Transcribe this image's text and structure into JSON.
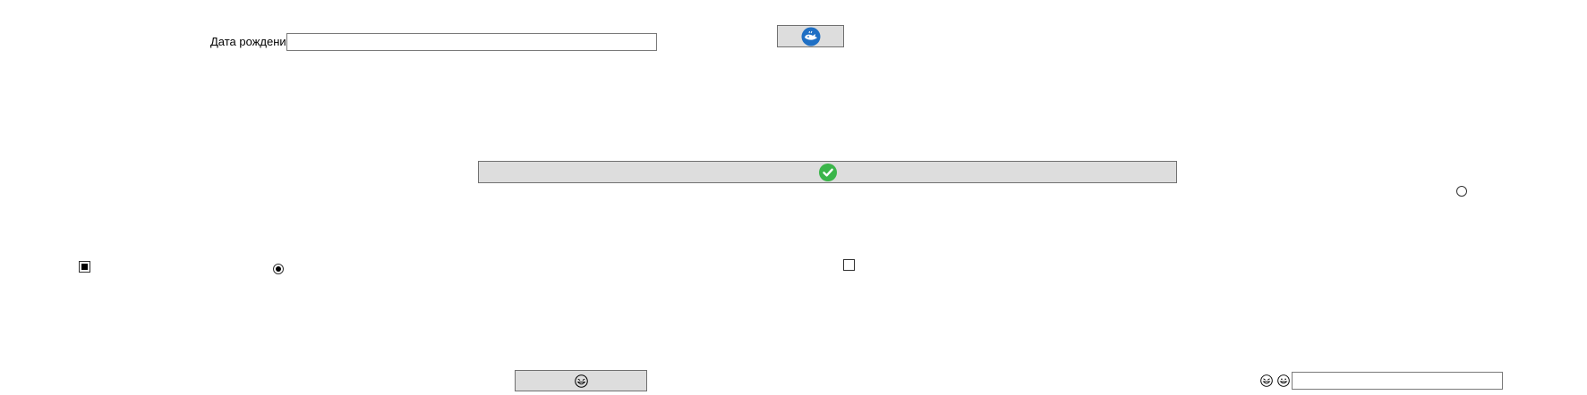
{
  "form": {
    "birth_date_label": "Дата рождения",
    "birth_date_value": "",
    "text_field_value": ""
  },
  "controls": {
    "checkbox_left_checked": true,
    "checkbox_middle_checked": false,
    "radio_left_selected": true,
    "radio_right_selected": false
  },
  "icons": {
    "top_button_icon": "whale-icon",
    "wide_button_icon": "green-checkmark-icon",
    "bottom_button_icon": "laughing-face-icon",
    "emoji_left": "laughing-face-icon",
    "emoji_right": "grinning-face-icon"
  },
  "colors": {
    "button_bg": "#dddddd",
    "whale_blue": "#1f6fc4",
    "check_green": "#3bb54a"
  }
}
